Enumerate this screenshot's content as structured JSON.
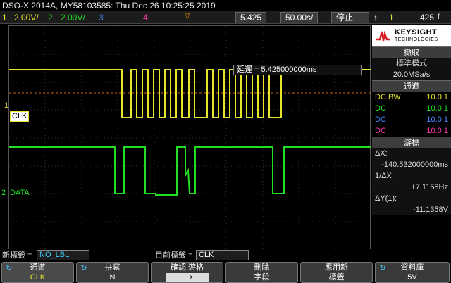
{
  "title": "DSO-X 2014A, MY58103585: Thu Dec 26 10:25:25 2019",
  "channels": {
    "ch1_num": "1",
    "ch1_scale": "2.00V/",
    "ch2_num": "2",
    "ch2_scale": "2.00V/",
    "ch3_num": "3",
    "ch4_num": "4",
    "time_pos": "5.425",
    "time_scale": "50.00s/",
    "run_state": "停止",
    "trig_icon": "f",
    "trig_src": "1",
    "trig_level": "425"
  },
  "delay_label": "延遲 = 5.425000000ms",
  "trace_labels": {
    "clk": "CLK",
    "data": "DATA",
    "ch1_marker": "1",
    "ch2_marker": "2"
  },
  "brand": {
    "name": "KEYSIGHT",
    "sub": "TECHNOLOGIES"
  },
  "sidebar": {
    "acq_header": "擷取",
    "acq_mode": "標準模式",
    "acq_rate": "20.0MSa/s",
    "chan_header": "通道",
    "chan_rows": [
      {
        "coupling": "DC BW",
        "ratio": "10.0:1",
        "color": "#e5e52a"
      },
      {
        "coupling": "DC",
        "ratio": "10.0:1",
        "color": "#22dd22"
      },
      {
        "coupling": "DC",
        "ratio": "10.0:1",
        "color": "#4488ff"
      },
      {
        "coupling": "DC",
        "ratio": "10.0:1",
        "color": "#ff3ab0"
      }
    ],
    "meas_header": "游標",
    "dx_label": "ΔX:",
    "dx_value": "-140.532000000ms",
    "inv_dx_label": "1/ΔX:",
    "inv_dx_value": "+7.1158Hz",
    "dy_label": "ΔY(1):",
    "dy_value": "-11.1358V"
  },
  "bottom": {
    "new_label_title": "新標籤 =",
    "new_label_value": "NO_LBL",
    "current_label_title": "目前標籤 =",
    "current_label_value": "CLK"
  },
  "softkeys": [
    {
      "title": "通道",
      "value": "CLK"
    },
    {
      "title": "拼寫",
      "value": "N"
    },
    {
      "title": "確認 遊格",
      "value": "⟶"
    },
    {
      "title": "刪除",
      "value": "字段"
    },
    {
      "title": "應用新",
      "value": "標籤"
    },
    {
      "title": "資料庫",
      "value": "5V"
    }
  ],
  "colors": {
    "ch1": "#e5e52a",
    "ch2": "#22dd22",
    "ch3": "#4488ff",
    "ch4": "#ff3ab0",
    "trig": "#ff8c00"
  }
}
